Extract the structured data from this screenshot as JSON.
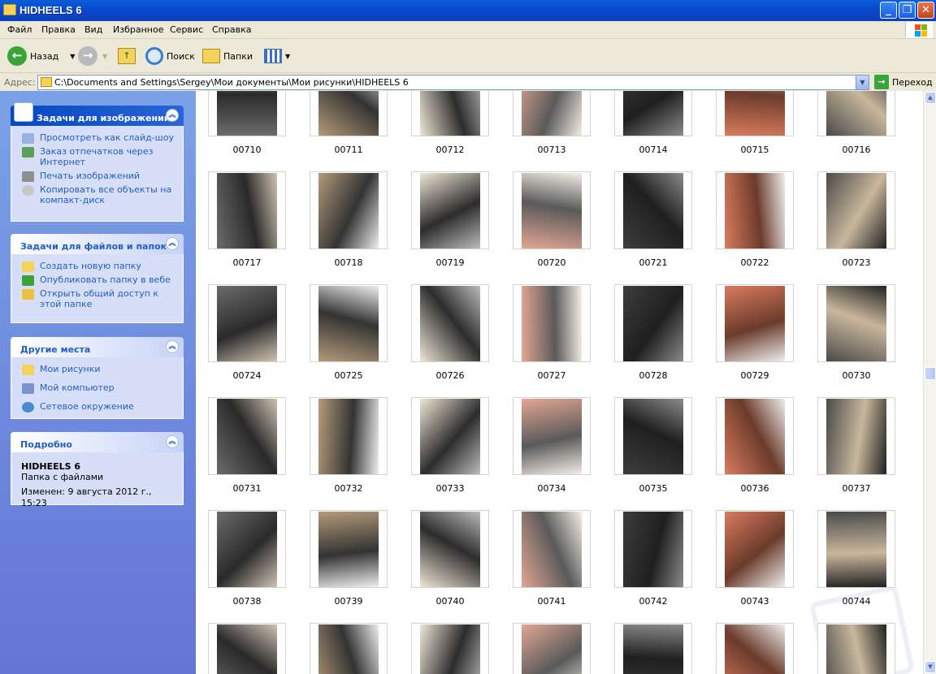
{
  "window": {
    "title": "HIDHEELS 6"
  },
  "menu": [
    "Файл",
    "Правка",
    "Вид",
    "Избранное",
    "Сервис",
    "Справка"
  ],
  "toolbar": {
    "back": "Назад",
    "search": "Поиск",
    "folders": "Папки"
  },
  "address": {
    "label": "Адрес:",
    "path": "C:\\Documents and Settings\\Sergey\\Мои документы\\Мои рисунки\\HIDHEELS 6",
    "go": "Переход"
  },
  "sidebar": {
    "image_tasks": {
      "title": "Задачи для изображений",
      "items": [
        "Просмотреть как слайд-шоу",
        "Заказ отпечатков через Интернет",
        "Печать изображений",
        "Копировать все объекты на компакт-диск"
      ]
    },
    "file_tasks": {
      "title": "Задачи для файлов и папок",
      "items": [
        "Создать новую папку",
        "Опубликовать папку в вебе",
        "Открыть общий доступ к этой папке"
      ]
    },
    "other_places": {
      "title": "Другие места",
      "items": [
        "Мои рисунки",
        "Мой компьютер",
        "Сетевое окружение"
      ]
    },
    "details": {
      "title": "Подробно",
      "name": "HIDHEELS 6",
      "type": "Папка с файлами",
      "modified": "Изменен: 9 августа 2012 г., 15:23"
    }
  },
  "files": [
    "00710",
    "00711",
    "00712",
    "00713",
    "00714",
    "00715",
    "00716",
    "00717",
    "00718",
    "00719",
    "00720",
    "00721",
    "00722",
    "00723",
    "00724",
    "00725",
    "00726",
    "00727",
    "00728",
    "00729",
    "00730",
    "00731",
    "00732",
    "00733",
    "00734",
    "00735",
    "00736",
    "00737",
    "00738",
    "00739",
    "00740",
    "00741",
    "00742",
    "00743",
    "00744",
    "",
    "",
    "",
    "",
    "",
    "",
    ""
  ],
  "colors": {
    "title_bar": "#0a4ad0",
    "sidebar": "#7ba2e7",
    "link": "#215dc6"
  }
}
